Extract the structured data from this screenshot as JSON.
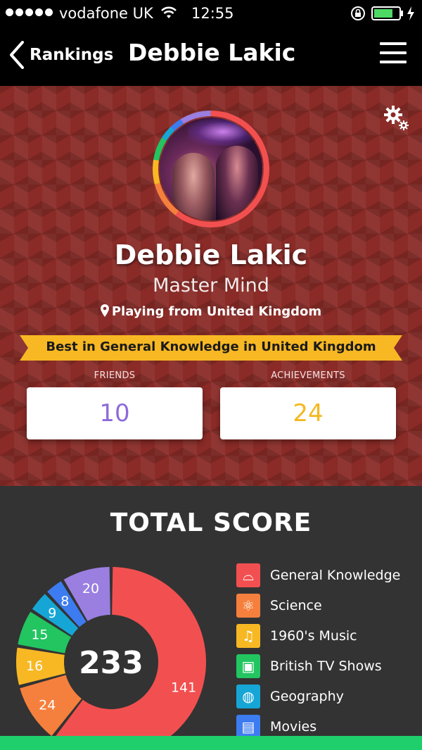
{
  "status_bar": {
    "carrier": "vodafone UK",
    "time": "12:55"
  },
  "nav": {
    "back_label": "Rankings",
    "title": "Debbie Lakic"
  },
  "profile": {
    "name": "Debbie Lakic",
    "rank": "Master Mind",
    "location": "Playing from United Kingdom",
    "banner": "Best in General Knowledge in United Kingdom",
    "friends_label": "FRIENDS",
    "friends_value": "10",
    "achievements_label": "ACHIEVEMENTS",
    "achievements_value": "24"
  },
  "score": {
    "title": "TOTAL SCORE",
    "total": "233"
  },
  "chart_data": {
    "type": "pie",
    "total": 233,
    "slices": [
      {
        "name": "General Knowledge",
        "value": 141,
        "color": "#f25050",
        "icon": "glasses-icon"
      },
      {
        "name": "Science",
        "value": 24,
        "color": "#f5803d",
        "icon": "atom-icon"
      },
      {
        "name": "1960's Music",
        "value": 16,
        "color": "#f7b824",
        "icon": "music-note-icon"
      },
      {
        "name": "British TV Shows",
        "value": 15,
        "color": "#22c560",
        "icon": "tv-icon"
      },
      {
        "name": "Geography",
        "value": 9,
        "color": "#16a6d6",
        "icon": "globe-icon"
      },
      {
        "name": "Movies",
        "value": 8,
        "color": "#3d7cf0",
        "icon": "film-icon"
      },
      {
        "name": "",
        "value": 20,
        "color": "#9a7ee0"
      }
    ]
  },
  "legend": [
    {
      "label": "General Knowledge",
      "color": "#f25050",
      "glyph": "⌓"
    },
    {
      "label": "Science",
      "color": "#f5803d",
      "glyph": "⚛"
    },
    {
      "label": "1960's Music",
      "color": "#f7b824",
      "glyph": "♫"
    },
    {
      "label": "British TV Shows",
      "color": "#22c560",
      "glyph": "▣"
    },
    {
      "label": "Geography",
      "color": "#16a6d6",
      "glyph": "◍"
    },
    {
      "label": "Movies",
      "color": "#3d7cf0",
      "glyph": "▤"
    }
  ]
}
